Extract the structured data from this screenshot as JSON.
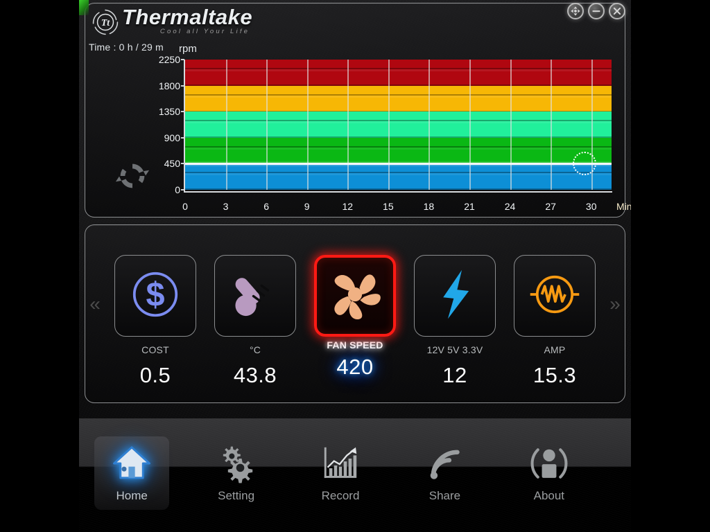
{
  "window": {
    "buttons": [
      {
        "name": "move-button",
        "icon": "move-arrows-icon",
        "label": "Move"
      },
      {
        "name": "minimize-button",
        "icon": "minimize-icon",
        "label": "Minimize"
      },
      {
        "name": "close-button",
        "icon": "close-icon",
        "label": "Close"
      }
    ]
  },
  "header": {
    "brand_name": "Thermaltake",
    "brand_tagline": "Cool all Your Life",
    "time_label": "Time : 0 h / 29 m",
    "refresh_icon": "refresh-icon"
  },
  "chart_data": {
    "type": "line",
    "title": "",
    "ylabel": "rpm",
    "xlabel": "Min",
    "xlim": [
      0,
      31.5
    ],
    "ylim": [
      0,
      2250
    ],
    "grid": true,
    "categories": [
      "0",
      "3",
      "6",
      "9",
      "12",
      "15",
      "18",
      "21",
      "24",
      "27",
      "30"
    ],
    "x": [
      0,
      3,
      6,
      9,
      12,
      15,
      18,
      21,
      24,
      27,
      30
    ],
    "yticks": [
      0,
      450,
      900,
      1350,
      1800,
      2250
    ],
    "ytick_labels": [
      "0",
      "450",
      "900",
      "1350",
      "1800",
      "2250"
    ],
    "series": [
      {
        "name": "Fan speed",
        "color": "#f3f6f8",
        "values": [
          450,
          450,
          450,
          450,
          450,
          450,
          450,
          450,
          450,
          450,
          450
        ]
      }
    ],
    "cursor": {
      "x": 29.5,
      "y": 450,
      "style": "dotted-circle"
    },
    "zones": [
      {
        "label": "blue-zone",
        "from": 0,
        "to": 450,
        "color": "#0d8fd6"
      },
      {
        "label": "green-zone",
        "from": 450,
        "to": 900,
        "color": "#0ab814"
      },
      {
        "label": "spring-zone",
        "from": 900,
        "to": 1350,
        "color": "#21f09b"
      },
      {
        "label": "amber-zone",
        "from": 1350,
        "to": 1800,
        "color": "#f7b705"
      },
      {
        "label": "red-zone",
        "from": 1800,
        "to": 2250,
        "color": "#b00710"
      }
    ]
  },
  "gauges": {
    "prev_arrow": "«",
    "next_arrow": "»",
    "tiles": [
      {
        "id": "cost",
        "icon": "dollar-circle-icon",
        "label": "COST",
        "value": "0.5",
        "selected": false,
        "color": "#7b8cf0"
      },
      {
        "id": "temp",
        "icon": "thermometer-icon",
        "label": "°C",
        "value": "43.8",
        "selected": false,
        "color": "#b89ac0"
      },
      {
        "id": "fan-speed",
        "icon": "fan-icon",
        "label": "FAN SPEED",
        "value": "420",
        "selected": true,
        "color": "#f0b183"
      },
      {
        "id": "voltage",
        "icon": "lightning-bolt-icon",
        "label": "12V 5V 3.3V",
        "value": "12",
        "selected": false,
        "color": "#21a7e8"
      },
      {
        "id": "amp",
        "icon": "resistor-circle-icon",
        "label": "AMP",
        "value": "15.3",
        "selected": false,
        "color": "#f79a12"
      }
    ]
  },
  "nav": {
    "items": [
      {
        "id": "home",
        "icon": "home-icon",
        "label": "Home",
        "active": true
      },
      {
        "id": "setting",
        "icon": "gears-icon",
        "label": "Setting",
        "active": false
      },
      {
        "id": "record",
        "icon": "chart-icon",
        "label": "Record",
        "active": false
      },
      {
        "id": "share",
        "icon": "rss-icon",
        "label": "Share",
        "active": false
      },
      {
        "id": "about",
        "icon": "person-icon",
        "label": "About",
        "active": false
      }
    ]
  },
  "colors": {
    "accent_green": "#39d12a",
    "selected_red": "#ff1a14",
    "value_glow_blue": "#1565ff"
  }
}
